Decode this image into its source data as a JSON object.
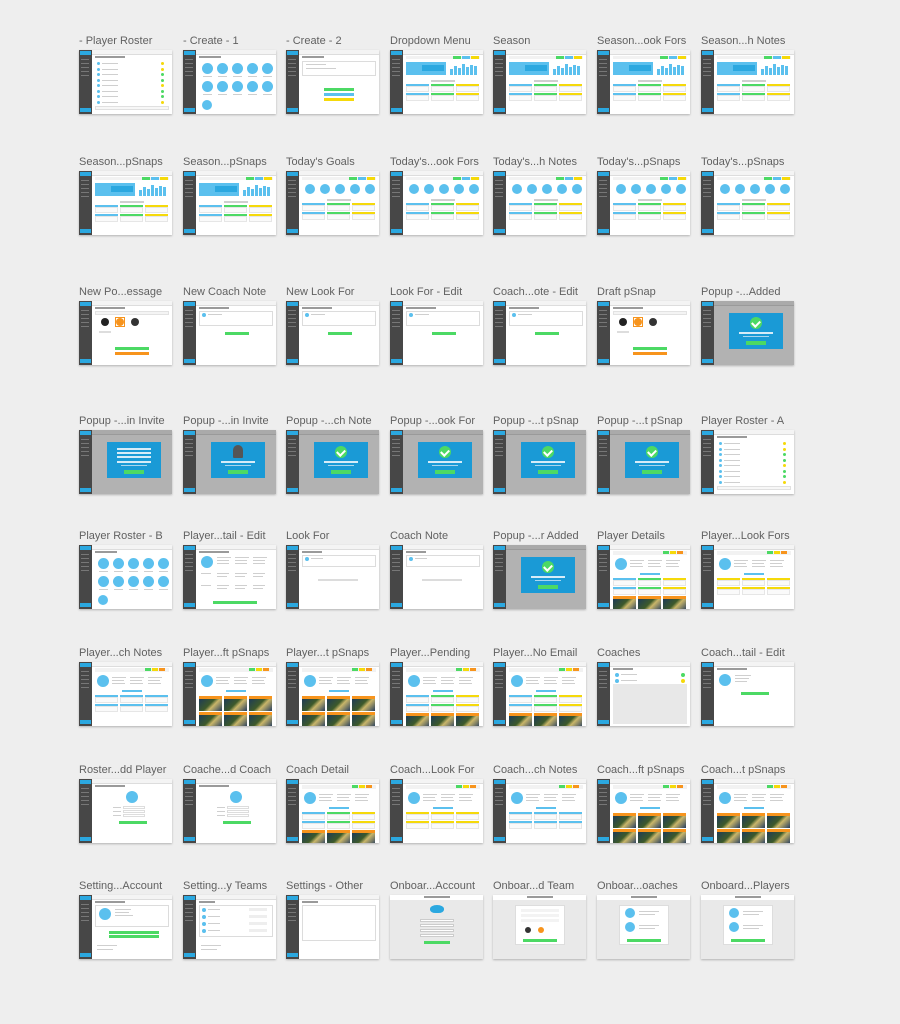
{
  "artboards": [
    {
      "label": "- Player Roster",
      "type": "roster_list"
    },
    {
      "label": "- Create - 1",
      "type": "circles"
    },
    {
      "label": "- Create - 2",
      "type": "create2"
    },
    {
      "label": "Dropdown Menu",
      "type": "dashboard_bars"
    },
    {
      "label": "Season",
      "type": "dashboard_bars"
    },
    {
      "label": "Season...ook Fors",
      "type": "dashboard_bars"
    },
    {
      "label": "Season...h Notes",
      "type": "dashboard_bars"
    },
    {
      "label": "Season...pSnaps",
      "type": "dashboard_bars"
    },
    {
      "label": "Season...pSnaps",
      "type": "dashboard_bars"
    },
    {
      "label": "Today's Goals",
      "type": "dashboard_circles"
    },
    {
      "label": "Today's...ook Fors",
      "type": "dashboard_circles"
    },
    {
      "label": "Today's...h Notes",
      "type": "dashboard_circles"
    },
    {
      "label": "Today's...pSnaps",
      "type": "dashboard_circles"
    },
    {
      "label": "Today's...pSnaps",
      "type": "dashboard_circles"
    },
    {
      "label": "New Po...essage",
      "type": "message"
    },
    {
      "label": "New Coach Note",
      "type": "form"
    },
    {
      "label": "New Look For",
      "type": "form"
    },
    {
      "label": "Look For - Edit",
      "type": "form"
    },
    {
      "label": "Coach...ote - Edit",
      "type": "form"
    },
    {
      "label": "Draft pSnap",
      "type": "message"
    },
    {
      "label": "Popup -...Added",
      "type": "popup_success"
    },
    {
      "label": "Popup -...in Invite",
      "type": "popup_text"
    },
    {
      "label": "Popup -...in Invite",
      "type": "popup_person"
    },
    {
      "label": "Popup -...ch Note",
      "type": "popup_success"
    },
    {
      "label": "Popup -...ook For",
      "type": "popup_success"
    },
    {
      "label": "Popup -...t pSnap",
      "type": "popup_success"
    },
    {
      "label": "Popup -...t pSnap",
      "type": "popup_success"
    },
    {
      "label": "Player Roster - A",
      "type": "roster_list"
    },
    {
      "label": "Player Roster - B",
      "type": "circles"
    },
    {
      "label": "Player...tail - Edit",
      "type": "detail_edit"
    },
    {
      "label": "Look For",
      "type": "simple_list"
    },
    {
      "label": "Coach Note",
      "type": "simple_list"
    },
    {
      "label": "Popup -...r Added",
      "type": "popup_success"
    },
    {
      "label": "Player Details",
      "type": "profile_cards"
    },
    {
      "label": "Player...Look Fors",
      "type": "profile_yellow"
    },
    {
      "label": "Player...ch Notes",
      "type": "profile_blue"
    },
    {
      "label": "Player...ft pSnaps",
      "type": "profile_photos"
    },
    {
      "label": "Player...t pSnaps",
      "type": "profile_photos"
    },
    {
      "label": "Player...Pending",
      "type": "profile_cards"
    },
    {
      "label": "Player...No Email",
      "type": "profile_cards"
    },
    {
      "label": "Coaches",
      "type": "coaches"
    },
    {
      "label": "Coach...tail - Edit",
      "type": "coach_edit"
    },
    {
      "label": "Roster...dd Player",
      "type": "add_form"
    },
    {
      "label": "Coache...d Coach",
      "type": "add_form"
    },
    {
      "label": "Coach Detail",
      "type": "profile_cards"
    },
    {
      "label": "Coach...Look For",
      "type": "profile_yellow"
    },
    {
      "label": "Coach...ch Notes",
      "type": "profile_blue"
    },
    {
      "label": "Coach...ft pSnaps",
      "type": "profile_photos"
    },
    {
      "label": "Coach...t pSnaps",
      "type": "profile_photos"
    },
    {
      "label": "Setting...Account",
      "type": "settings_account"
    },
    {
      "label": "Setting...y Teams",
      "type": "settings_teams"
    },
    {
      "label": "Settings - Other",
      "type": "settings_other"
    },
    {
      "label": "Onboar...Account",
      "type": "onboard_account"
    },
    {
      "label": "Onboar...d Team",
      "type": "onboard_team"
    },
    {
      "label": "Onboar...oaches",
      "type": "onboard_people"
    },
    {
      "label": "Onboard...Players",
      "type": "onboard_people"
    }
  ],
  "colors": {
    "sidebar": "#474747",
    "accent_blue": "#2ba8e0",
    "light_blue": "#5bc0ee",
    "green": "#4cd964",
    "yellow": "#f5d90a",
    "orange": "#f7941d",
    "modal_blue": "#1a9ad6"
  }
}
